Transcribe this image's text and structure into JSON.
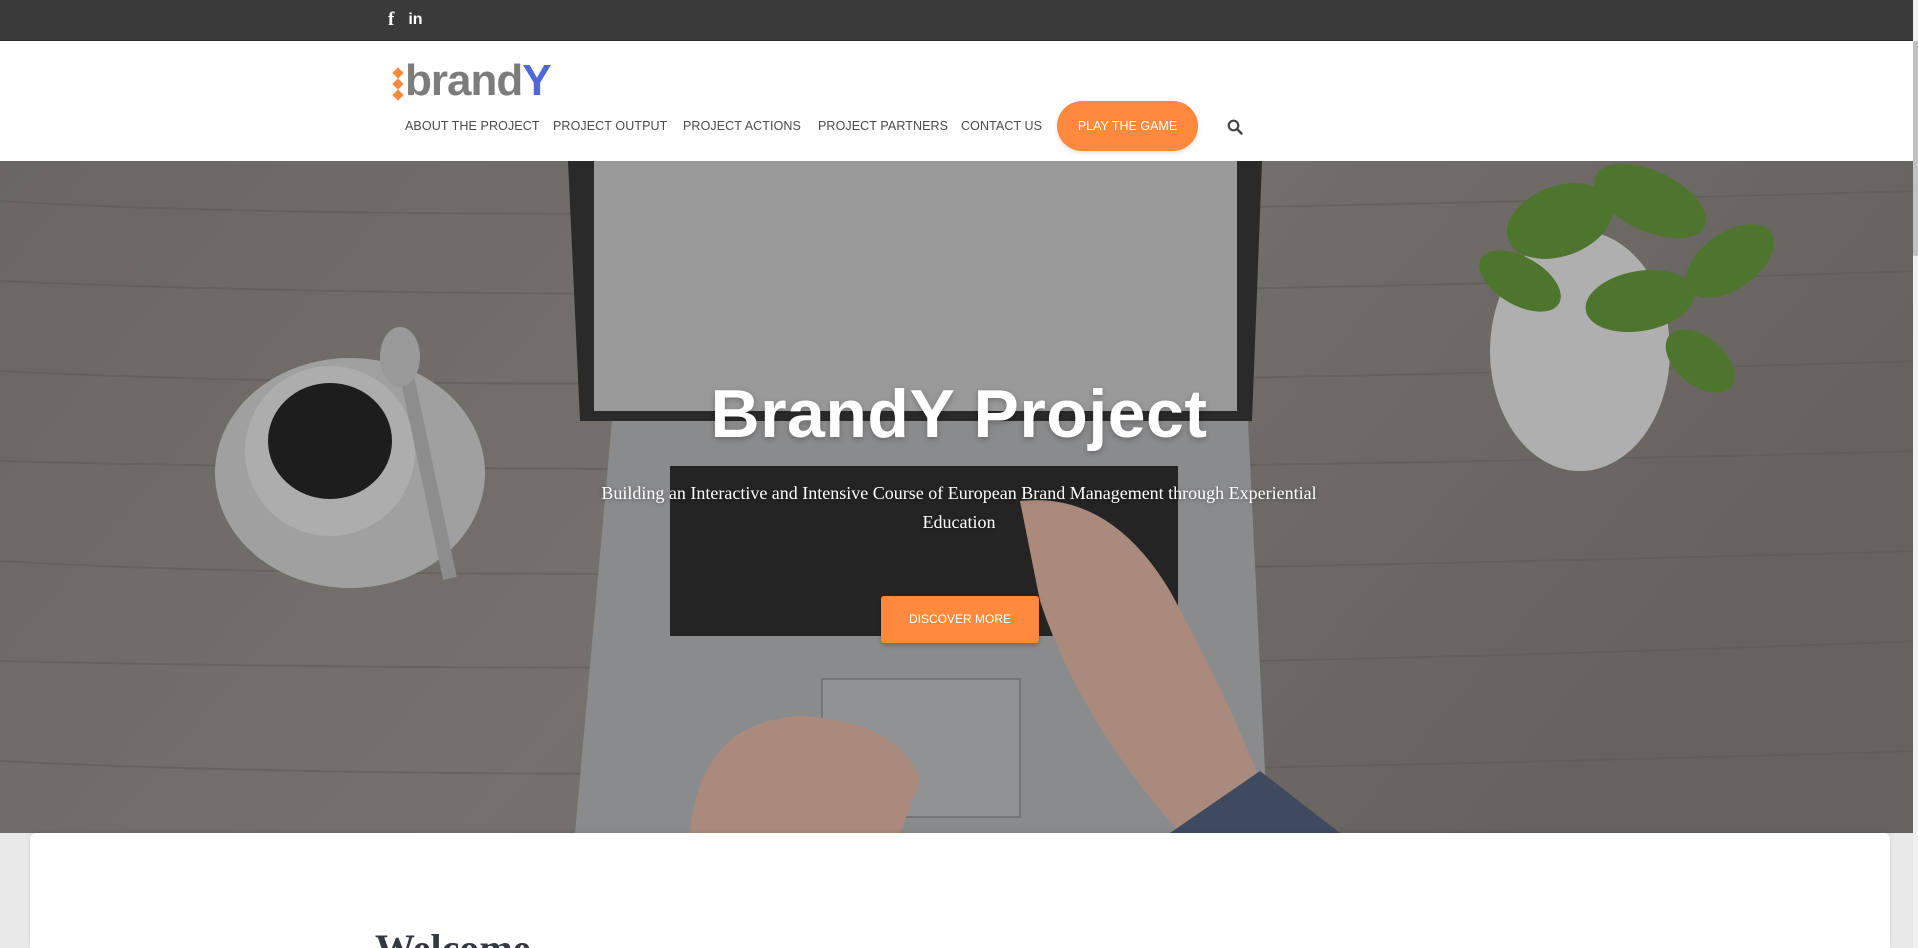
{
  "social": {
    "facebook_glyph": "f",
    "linkedin_glyph": "in"
  },
  "logo": {
    "part1": "brand",
    "part2": "Y",
    "accent": "#ff8a3d",
    "brand_gray": "#7c7c7c",
    "brand_blue": "#4f67d9"
  },
  "nav": {
    "items": [
      {
        "label": "ABOUT THE PROJECT"
      },
      {
        "label": "PROJECT OUTPUT"
      },
      {
        "label": "PROJECT ACTIONS"
      },
      {
        "label": "PROJECT PARTNERS"
      },
      {
        "label": "CONTACT US"
      }
    ],
    "cta_label": "PLAY THE GAME",
    "search_icon": "search-icon"
  },
  "hero": {
    "title": "BrandY Project",
    "subtitle": "Building an Interactive and Intensive Course of European Brand Management through Experiential Education",
    "button_label": "DISCOVER MORE"
  },
  "content": {
    "heading": "Welcome"
  },
  "colors": {
    "accent": "#ff8a3d",
    "topbar": "#3a3a3a"
  }
}
